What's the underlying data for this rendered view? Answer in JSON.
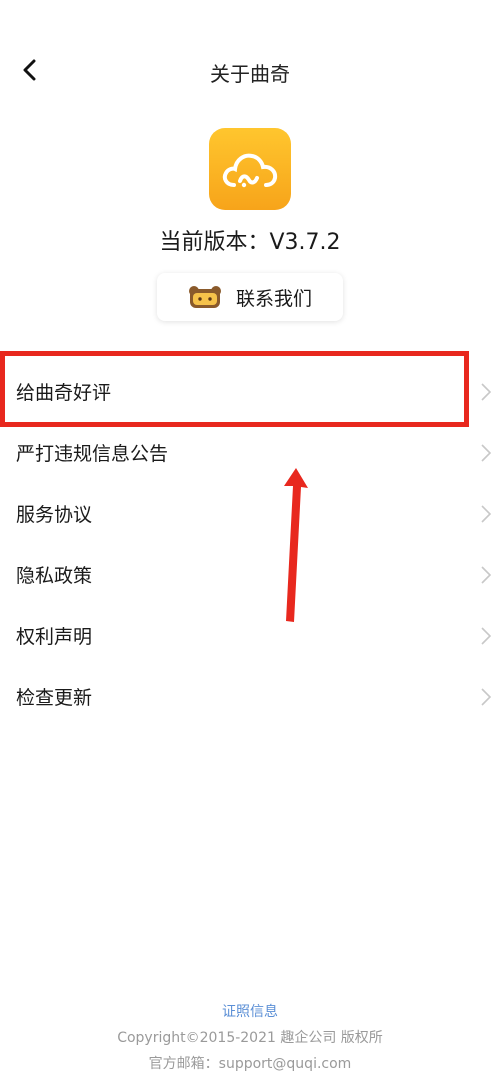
{
  "header": {
    "title": "关于曲奇"
  },
  "app": {
    "version_text": "当前版本：V3.7.2"
  },
  "contact": {
    "label": "联系我们"
  },
  "menu": {
    "items": [
      {
        "label": "给曲奇好评"
      },
      {
        "label": "严打违规信息公告"
      },
      {
        "label": "服务协议"
      },
      {
        "label": "隐私政策"
      },
      {
        "label": "权利声明"
      },
      {
        "label": "检查更新"
      }
    ]
  },
  "footer": {
    "license_link": "证照信息",
    "copyright": "Copyright©2015-2021 趣企公司 版权所",
    "email": "官方邮箱：support@quqi.com"
  },
  "colors": {
    "brand": "#f7a41a",
    "annotation": "#e8281e",
    "link": "#5b8fd6"
  }
}
